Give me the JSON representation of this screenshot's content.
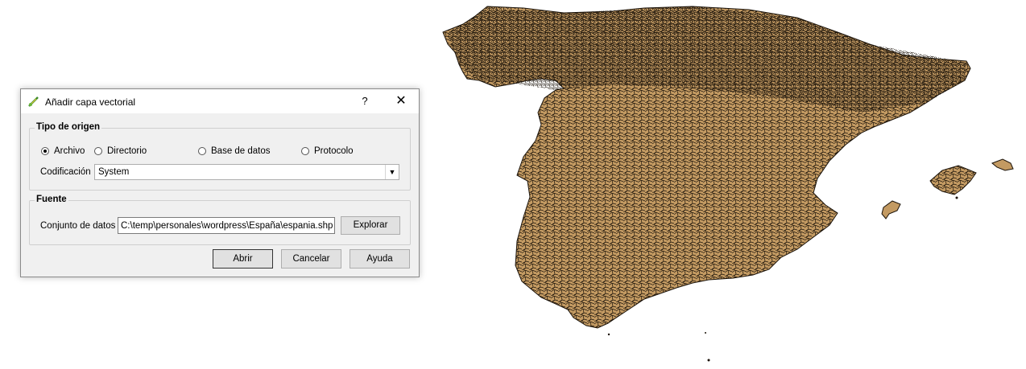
{
  "map": {
    "fill_color": "#c39a62",
    "stroke_color": "#1a1209"
  },
  "dialog": {
    "title": "Añadir capa vectorial",
    "help_label": "?",
    "close_label": "✕",
    "source_type": {
      "legend": "Tipo de origen",
      "options": [
        {
          "label": "Archivo",
          "checked": true
        },
        {
          "label": "Directorio",
          "checked": false
        },
        {
          "label": "Base de datos",
          "checked": false
        },
        {
          "label": "Protocolo",
          "checked": false
        }
      ],
      "encoding_label": "Codificación",
      "encoding_value": "System"
    },
    "source": {
      "legend": "Fuente",
      "dataset_label": "Conjunto de datos",
      "dataset_value": "C:\\temp\\personales\\wordpress\\España\\espania.shp",
      "browse_label": "Explorar"
    },
    "buttons": {
      "open": "Abrir",
      "cancel": "Cancelar",
      "help": "Ayuda"
    }
  }
}
